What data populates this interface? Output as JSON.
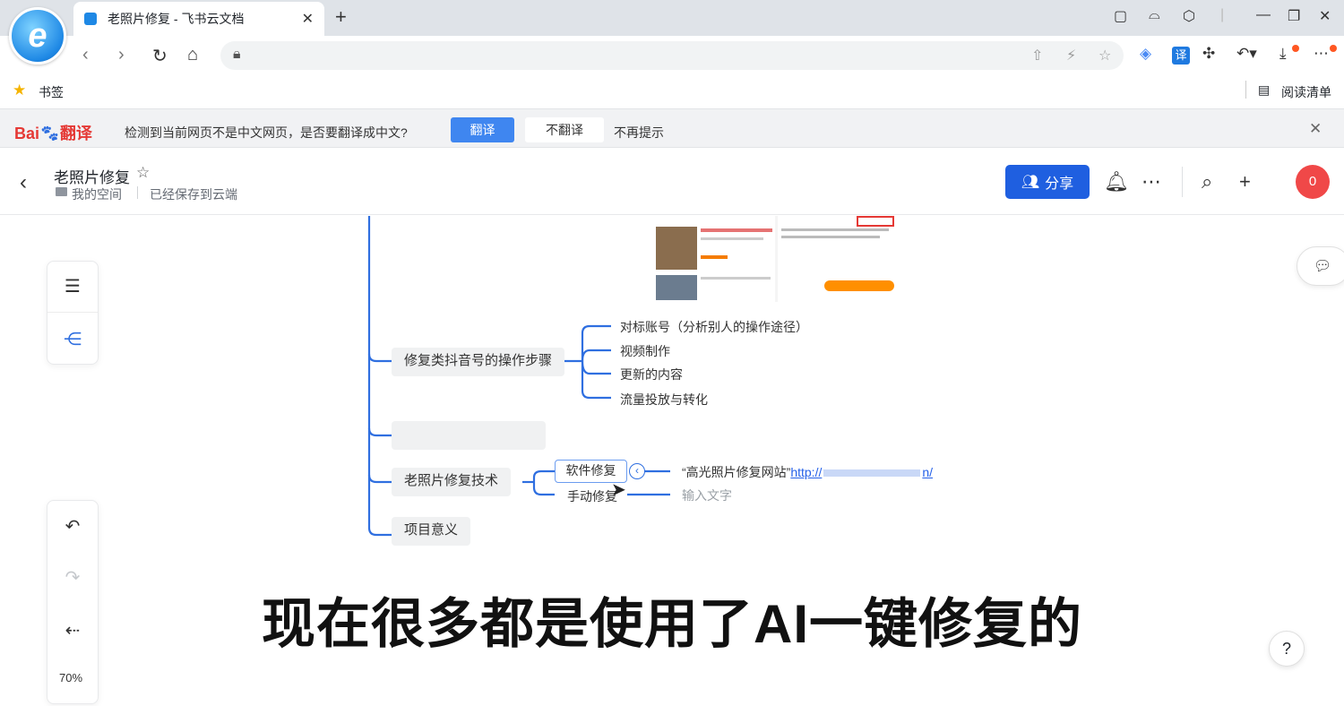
{
  "browser": {
    "tab_title": "老照片修复 - 飞书云文档",
    "bookmarks_label": "书签",
    "reading_list_label": "阅读清单"
  },
  "translate_bar": {
    "message": "检测到当前网页不是中文网页，是否要翻译成中文?",
    "translate_label": "翻译",
    "dont_translate_label": "不翻译",
    "never_label": "不再提示",
    "brand": "Bai",
    "brand_suffix": "翻译"
  },
  "doc": {
    "title": "老照片修复",
    "space": "我的空间",
    "save_status": "已经保存到云端",
    "share_label": "分享",
    "avatar_text": "0"
  },
  "toolbar": {
    "zoom": "70%"
  },
  "mindmap": {
    "branches": [
      {
        "label": "修复类抖音号的操作步骤",
        "children": [
          "对标账号（分析别人的操作途径）",
          "视频制作",
          "更新的内容",
          "流量投放与转化"
        ]
      },
      {
        "label": "",
        "children": []
      },
      {
        "label": "老照片修复技术",
        "children": [
          {
            "label": "软件修复",
            "note_prefix": "“高光照片修复网站”",
            "note_link": "http://",
            "note_link_tail": "n/"
          },
          {
            "label": "手动修复",
            "note_placeholder": "输入文字"
          }
        ]
      },
      {
        "label": "项目意义",
        "children": []
      }
    ]
  },
  "caption": "现在很多都是使用了AI一键修复的"
}
